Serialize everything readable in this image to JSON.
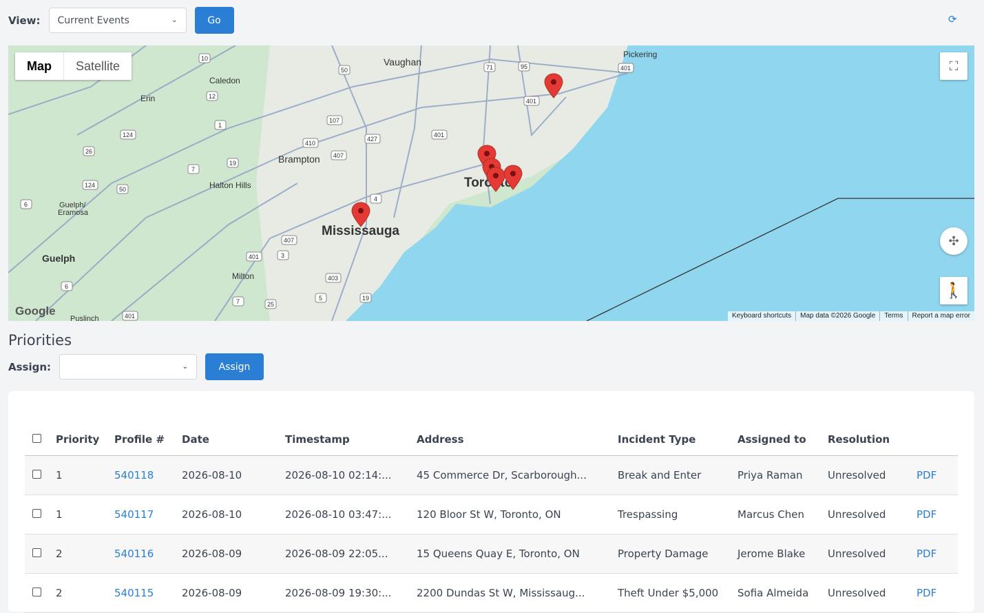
{
  "header": {
    "view_label": "View:",
    "view_selected": "Current Events",
    "go_label": "Go",
    "refresh_icon": "⟳"
  },
  "map": {
    "toggle_map": "Map",
    "toggle_satellite": "Satellite",
    "google_logo": "Google",
    "attribution": [
      "Keyboard shortcuts",
      "Map data ©2026 Google",
      "Terms",
      "Report a map error"
    ],
    "place_labels": [
      "Vaughan",
      "Pickering",
      "Caledon",
      "Erin",
      "Brampton",
      "Halton Hills",
      "Guelph/ Eramosa",
      "Toronto",
      "Mississauga",
      "Guelph",
      "Milton",
      "Puslinch"
    ],
    "road_shields": [
      "10",
      "50",
      "71",
      "95",
      "401",
      "12",
      "1",
      "124",
      "107",
      "427",
      "401",
      "26",
      "410",
      "407",
      "19",
      "7",
      "124",
      "50",
      "4",
      "6",
      "407",
      "401",
      "3",
      "403",
      "5",
      "19",
      "6",
      "7",
      "25",
      "401"
    ],
    "markers": 6
  },
  "priorities": {
    "title": "Priorities",
    "assign_label": "Assign:",
    "assign_selected": "",
    "assign_button": "Assign"
  },
  "table": {
    "columns": [
      "Priority",
      "Profile #",
      "Date",
      "Timestamp",
      "Address",
      "Incident Type",
      "Assigned to",
      "Resolution"
    ],
    "rows": [
      {
        "priority": "1",
        "profile": "540118",
        "date": "2026-08-10",
        "timestamp": "2026-08-10 02:14:...",
        "address": "45 Commerce Dr, Scarborough...",
        "incident": "Break and Enter",
        "assigned": "Priya Raman",
        "resolution": "Unresolved",
        "pdf": "PDF"
      },
      {
        "priority": "1",
        "profile": "540117",
        "date": "2026-08-10",
        "timestamp": "2026-08-10 03:47:...",
        "address": "120 Bloor St W, Toronto, ON",
        "incident": "Trespassing",
        "assigned": "Marcus Chen",
        "resolution": "Unresolved",
        "pdf": "PDF"
      },
      {
        "priority": "2",
        "profile": "540116",
        "date": "2026-08-09",
        "timestamp": "2026-08-09 22:05...",
        "address": "15 Queens Quay E, Toronto, ON",
        "incident": "Property Damage",
        "assigned": "Jerome Blake",
        "resolution": "Unresolved",
        "pdf": "PDF"
      },
      {
        "priority": "2",
        "profile": "540115",
        "date": "2026-08-09",
        "timestamp": "2026-08-09 19:30:...",
        "address": "2200 Dundas St W, Mississaug...",
        "incident": "Theft Under $5,000",
        "assigned": "Sofia Almeida",
        "resolution": "Unresolved",
        "pdf": "PDF"
      }
    ]
  },
  "colors": {
    "accent": "#2a7fd4",
    "water": "#8fd6ee",
    "land": "#cfe7cf",
    "marker": "#e53935"
  }
}
